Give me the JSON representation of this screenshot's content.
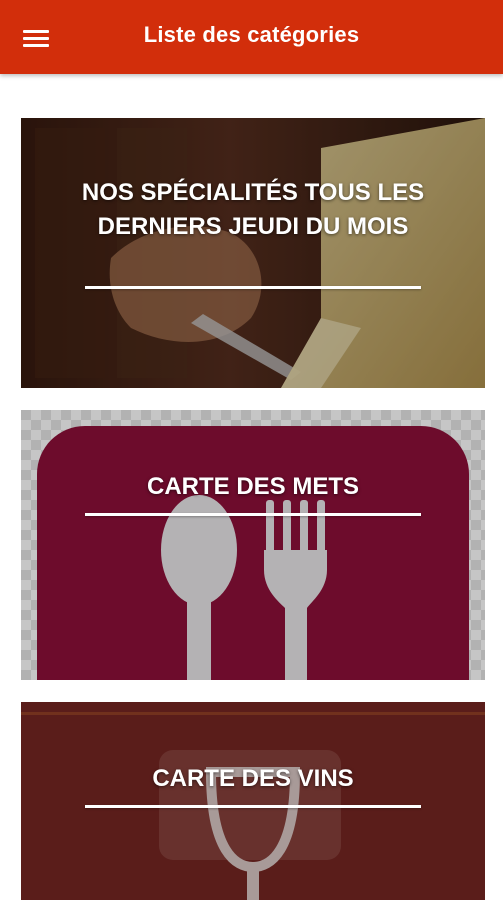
{
  "appbar": {
    "title": "Liste des catégories",
    "menu_icon": "hamburger-menu-icon",
    "color": "#d22e0b"
  },
  "categories": [
    {
      "label": "NOS SPÉCIALITÉS TOUS LES DERNIERS JEUDI DU MOIS",
      "image": "raclette-cheese-photo"
    },
    {
      "label": "CARTE DES METS",
      "image": "spoon-fork-icon",
      "color": "#6d0c2c"
    },
    {
      "label": "CARTE DES VINS",
      "image": "wine-glass-icon",
      "color": "#5a1d1a"
    }
  ]
}
